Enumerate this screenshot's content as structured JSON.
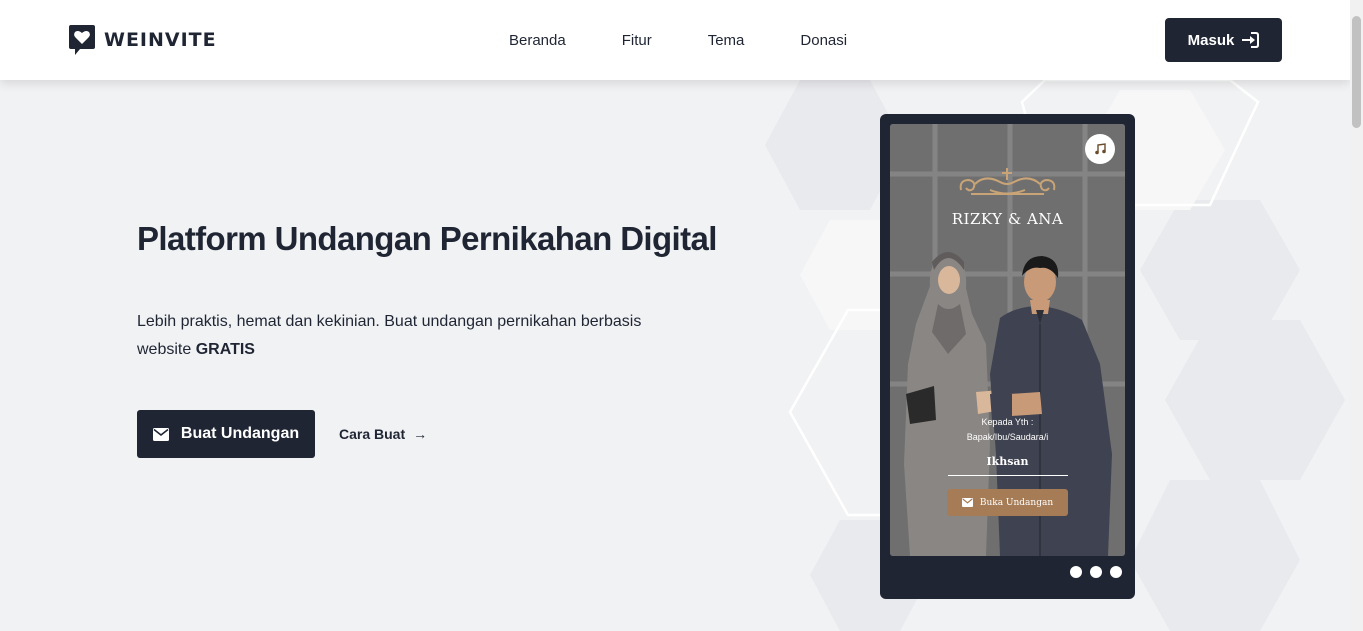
{
  "brand": {
    "name": "WEINVITE"
  },
  "nav": {
    "items": [
      "Beranda",
      "Fitur",
      "Tema",
      "Donasi"
    ]
  },
  "header": {
    "login_label": "Masuk"
  },
  "hero": {
    "title": "Platform Undangan Pernikahan Digital",
    "desc_text": "Lebih praktis, hemat dan kekinian. Buat undangan pernikahan berbasis website",
    "desc_bold": "GRATIS",
    "cta_label": "Buat Undangan",
    "how_label": "Cara Buat",
    "how_arrow": "→"
  },
  "preview": {
    "couple": "RIZKY & ANA",
    "greeting_line1": "Kepada Yth :",
    "greeting_line2": "Bapak/Ibu/Saudara/i",
    "guest": "Ikhsan",
    "open_label": "Buka Undangan",
    "slides": 3
  },
  "colors": {
    "primary": "#1f2533",
    "accent": "#a57c55",
    "background": "#f1f2f4"
  },
  "icons": {
    "logo": "heart-chat-icon",
    "login": "sign-in-icon",
    "cta": "envelope-icon",
    "music": "music-note-icon",
    "open": "envelope-icon"
  }
}
